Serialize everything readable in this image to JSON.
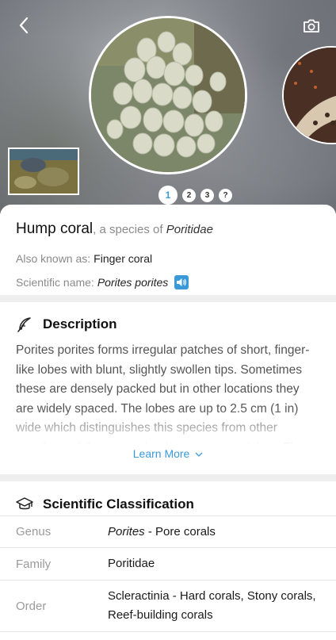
{
  "nav": {
    "back_icon": "chevron-left-icon",
    "camera_icon": "camera-icon"
  },
  "gallery": {
    "pages": [
      "1",
      "2",
      "3",
      "?"
    ],
    "active_page": "1"
  },
  "species": {
    "common_name": "Hump coral",
    "species_of_prefix": ", a species of ",
    "family_name": "Poritidae",
    "aka_label": "Also known as:",
    "aka_value": "Finger coral",
    "sci_label": "Scientific name:",
    "sci_value": "Porites porites",
    "speaker_icon": "speaker-icon"
  },
  "description": {
    "heading": "Description",
    "icon": "feather-icon",
    "text": "Porites porites forms irregular patches of short, finger-like lobes with blunt, slightly swollen tips. Sometimes these are densely packed but in other locations they are widely spaced. The lobes are up to 2.5 cm (1 in) wide which distinguishes this species from other members of the genus that have narrower lobes. They",
    "learn_more": "Learn More"
  },
  "classification": {
    "heading": "Scientific Classification",
    "icon": "graduation-cap-icon",
    "rows": [
      {
        "key": "Genus",
        "value_italic": "Porites",
        "value_rest": " - Pore corals"
      },
      {
        "key": "Family",
        "value_italic": "",
        "value_rest": "Poritidae"
      },
      {
        "key": "Order",
        "value_italic": "",
        "value_rest": "Scleractinia - Hard corals, Stony corals, Reef-building corals"
      }
    ]
  },
  "colors": {
    "accent": "#3a9ad9",
    "divider": "#eeeeee"
  }
}
